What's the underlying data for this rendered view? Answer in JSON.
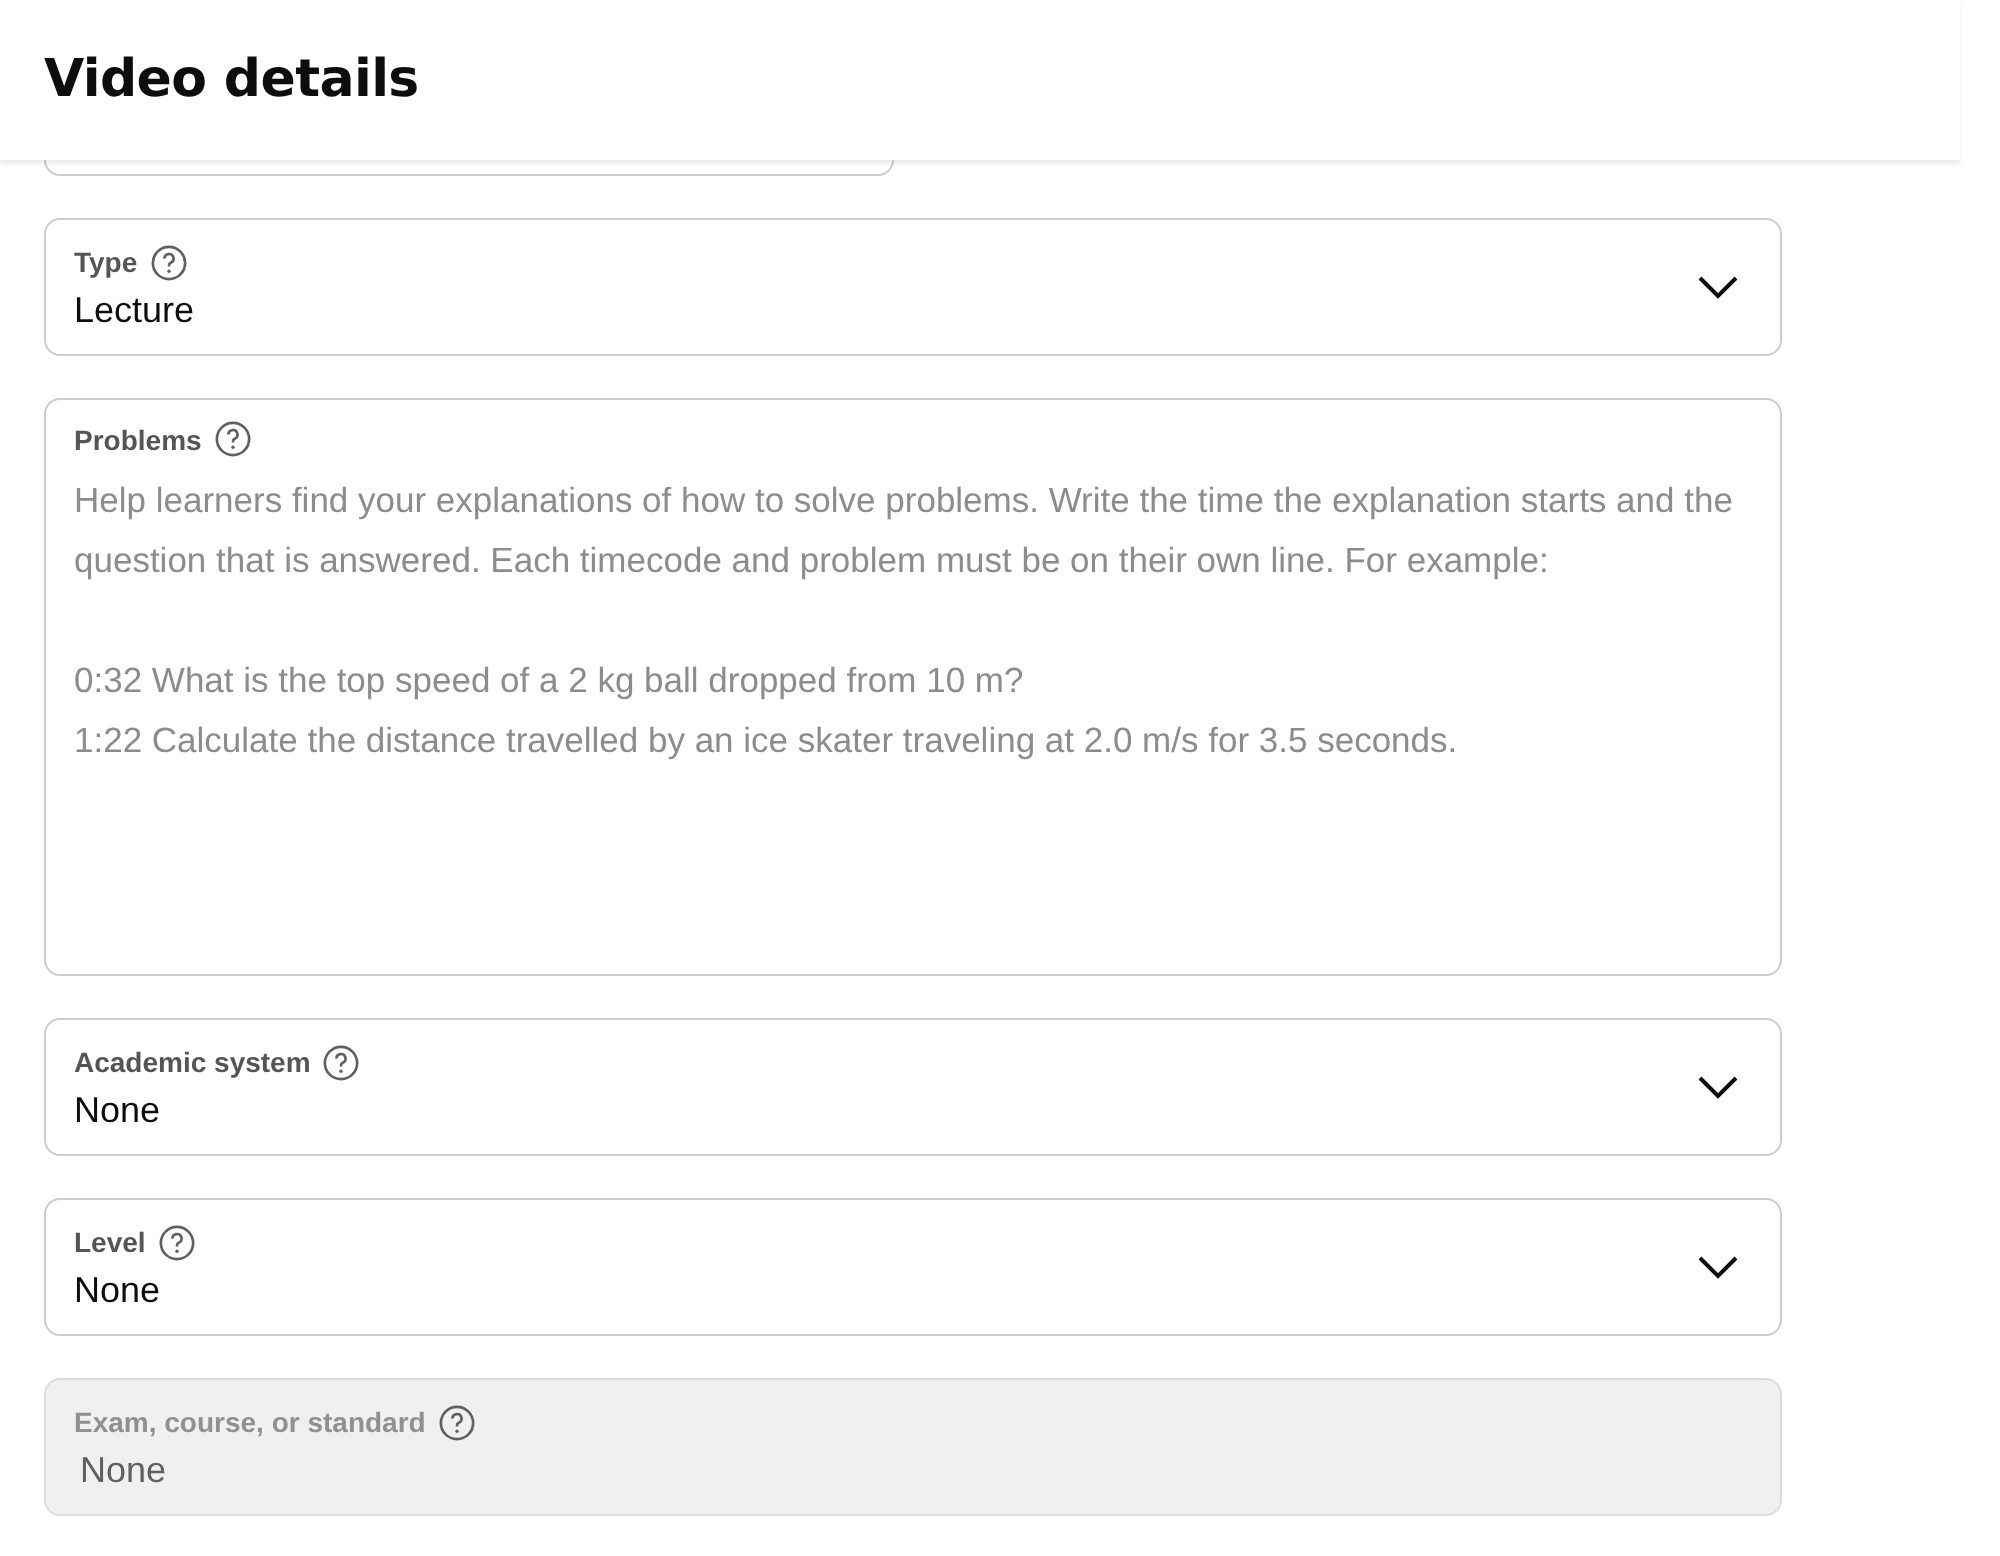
{
  "header": {
    "title": "Video details"
  },
  "fields": [
    {
      "kind": "select",
      "label": "Type",
      "value": "Lecture",
      "disabled": false
    },
    {
      "kind": "textarea",
      "label": "Problems",
      "placeholder": "Help learners find your explanations of how to solve problems. Write the time the explanation starts and the question that is answered. Each timecode and problem must be on their own line. For example:\n\n0:32 What is the top speed of a 2 kg ball dropped from 10 m?\n1:22 Calculate the distance travelled by an ice skater traveling at 2.0 m/s for 3.5 seconds.",
      "disabled": false
    },
    {
      "kind": "select",
      "label": "Academic system",
      "value": "None",
      "disabled": false
    },
    {
      "kind": "select",
      "label": "Level",
      "value": "None",
      "disabled": false
    },
    {
      "kind": "text",
      "label": "Exam, course, or standard",
      "value": "None",
      "disabled": true
    }
  ]
}
